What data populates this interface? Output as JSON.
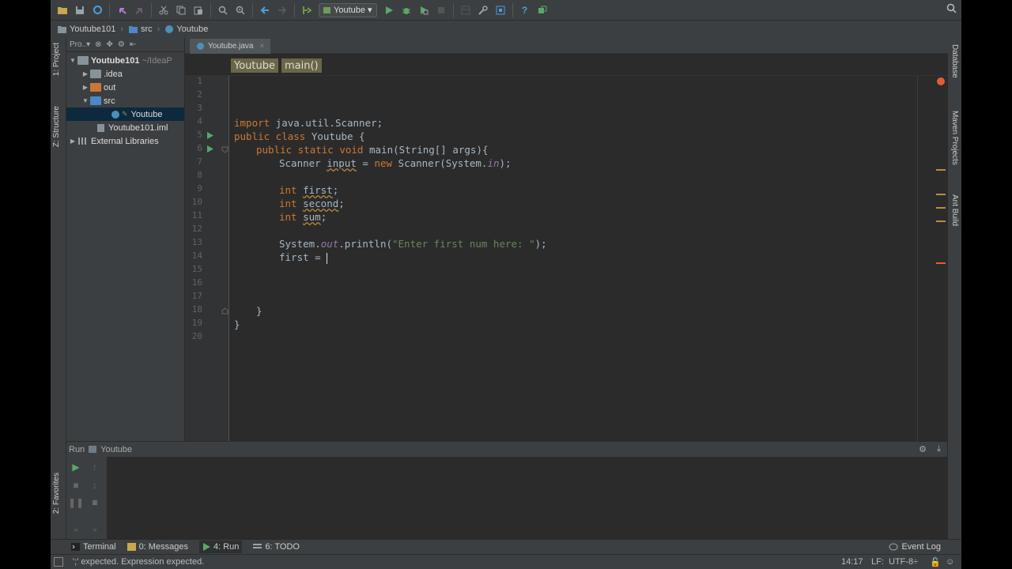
{
  "toolbar": {
    "run_config": "Youtube",
    "icons": [
      "open-folder-icon",
      "save-icon",
      "sync-icon",
      "undo-icon",
      "redo-icon",
      "cut-icon",
      "copy-icon",
      "paste-icon",
      "find-icon",
      "replace-icon",
      "back-icon",
      "forward-icon",
      "build-icon",
      "run-icon",
      "debug-icon",
      "coverage-icon",
      "stop-icon",
      "project-structure-icon",
      "settings-icon",
      "sdk-icon",
      "help-icon",
      "plugin-icon",
      "search-icon"
    ]
  },
  "navbar": {
    "crumbs": [
      "Youtube101",
      "src",
      "Youtube"
    ]
  },
  "left_strip": {
    "project_tab": "1: Project",
    "structure_tab": "Z: Structure",
    "favorites_tab": "2: Favorites"
  },
  "right_strip": {
    "database_tab": "Database",
    "maven_tab": "Maven Projects",
    "ant_tab": "Ant Build"
  },
  "project": {
    "view_label": "Pro..▾",
    "tree": [
      {
        "label": "Youtube101",
        "suffix": "~/IdeaP",
        "level": 0,
        "expanded": true
      },
      {
        "label": ".idea",
        "level": 1,
        "expanded": false
      },
      {
        "label": "out",
        "level": 1,
        "expanded": false
      },
      {
        "label": "src",
        "level": 1,
        "expanded": true
      },
      {
        "label": "Youtube",
        "level": 2,
        "selected": true
      },
      {
        "label": "Youtube101.iml",
        "level": 1
      },
      {
        "label": "External Libraries",
        "level": 0,
        "expanded": false
      }
    ]
  },
  "editor": {
    "tab_label": "Youtube.java",
    "breadcrumb_class": "Youtube",
    "breadcrumb_method": "main()",
    "line_numbers": [
      "1",
      "2",
      "3",
      "4",
      "5",
      "6",
      "7",
      "8",
      "9",
      "10",
      "11",
      "12",
      "13",
      "14",
      "15",
      "16",
      "17",
      "18",
      "19",
      "20"
    ],
    "code": {
      "l4_kw": "import",
      "l4_rest": " java.util.Scanner;",
      "l5_kw": "public class",
      "l5_rest": " Youtube {",
      "l6_kw": "public static void",
      "l6_rest": " main(String[] args){",
      "l7_a": "Scanner ",
      "l7_var": "input",
      "l7_b": " = ",
      "l7_new": "new",
      "l7_c": " Scanner(System.",
      "l7_in": "in",
      "l7_d": ");",
      "l9_kw": "int",
      "l9_var": "first",
      "l10_kw": "int",
      "l10_var": "second",
      "l11_kw": "int",
      "l11_var": "sum",
      "l13_a": "System.",
      "l13_out": "out",
      "l13_b": ".println(",
      "l13_str": "\"Enter first num here: \"",
      "l13_c": ");",
      "l14": "first = ",
      "l18": "}",
      "l19": "}"
    }
  },
  "run": {
    "label": "Run",
    "config": "Youtube"
  },
  "bottom_tabs": {
    "terminal": "Terminal",
    "messages": "0: Messages",
    "run": "4: Run",
    "todo": "6: TODO",
    "event_log": "Event Log"
  },
  "status": {
    "message": "';' expected. Expression expected.",
    "position": "14:17",
    "line_sep": "LF:",
    "encoding": "UTF-8÷"
  },
  "colors": {
    "background": "#3c3f41",
    "editor_bg": "#2b2b2b",
    "keyword": "#cc7832",
    "string": "#6a8759",
    "field": "#9876aa",
    "text": "#a9b7c6",
    "selection": "#0d293e"
  }
}
